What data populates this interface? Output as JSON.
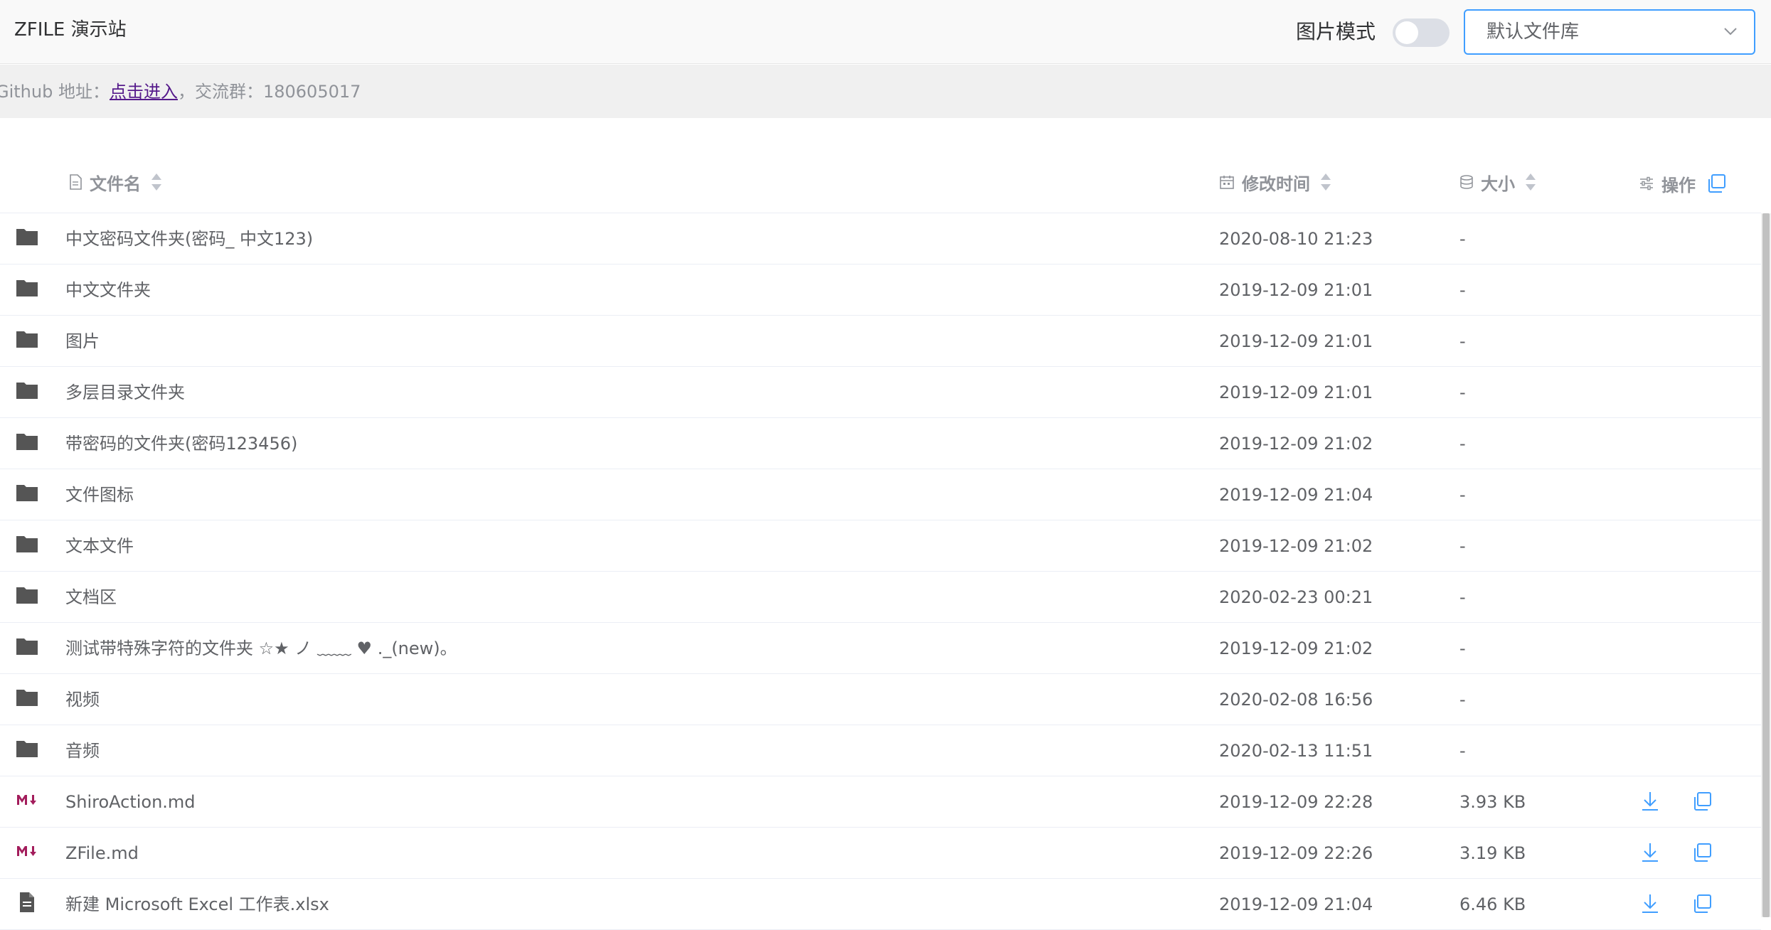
{
  "header": {
    "title": "ZFILE 演示站",
    "image_mode_label": "图片模式",
    "image_mode_on": false,
    "storage_select": "默认文件库"
  },
  "info": {
    "prefix": "Github 地址：",
    "link": "点击进入",
    "suffix": "，交流群：180605017"
  },
  "table": {
    "columns": {
      "name": "文件名",
      "time": "修改时间",
      "size": "大小",
      "ops": "操作"
    },
    "rows": [
      {
        "type": "folder",
        "name": "中文密码文件夹(密码_ 中文123)",
        "time": "2020-08-10 21:23",
        "size": "-"
      },
      {
        "type": "folder",
        "name": "中文文件夹",
        "time": "2019-12-09 21:01",
        "size": "-"
      },
      {
        "type": "folder",
        "name": "图片",
        "time": "2019-12-09 21:01",
        "size": "-"
      },
      {
        "type": "folder",
        "name": "多层目录文件夹",
        "time": "2019-12-09 21:01",
        "size": "-"
      },
      {
        "type": "folder",
        "name": "带密码的文件夹(密码123456)",
        "time": "2019-12-09 21:02",
        "size": "-"
      },
      {
        "type": "folder",
        "name": "文件图标",
        "time": "2019-12-09 21:04",
        "size": "-"
      },
      {
        "type": "folder",
        "name": "文本文件",
        "time": "2019-12-09 21:02",
        "size": "-"
      },
      {
        "type": "folder",
        "name": "文档区",
        "time": "2020-02-23 00:21",
        "size": "-"
      },
      {
        "type": "folder",
        "name": "测试带特殊字符的文件夹 ☆★ ノ ﹏﹏ ♥ ._(new)。",
        "time": "2019-12-09 21:02",
        "size": "-"
      },
      {
        "type": "folder",
        "name": "视频",
        "time": "2020-02-08 16:56",
        "size": "-"
      },
      {
        "type": "folder",
        "name": "音频",
        "time": "2020-02-13 11:51",
        "size": "-"
      },
      {
        "type": "markdown",
        "name": "ShiroAction.md",
        "time": "2019-12-09 22:28",
        "size": "3.93 KB"
      },
      {
        "type": "markdown",
        "name": "ZFile.md",
        "time": "2019-12-09 22:26",
        "size": "3.19 KB"
      },
      {
        "type": "file",
        "name": "新建 Microsoft Excel 工作表.xlsx",
        "time": "2019-12-09 21:04",
        "size": "6.46 KB"
      }
    ]
  },
  "icons": {
    "folder": "folder-icon",
    "markdown": "markdown-icon",
    "file": "document-icon",
    "download": "download-icon",
    "copy": "copy-icon"
  },
  "colors": {
    "accent": "#409eff",
    "folder_icon": "#555555",
    "markdown_icon": "#a31d5c",
    "text": "#606266",
    "header_text": "#909399"
  }
}
